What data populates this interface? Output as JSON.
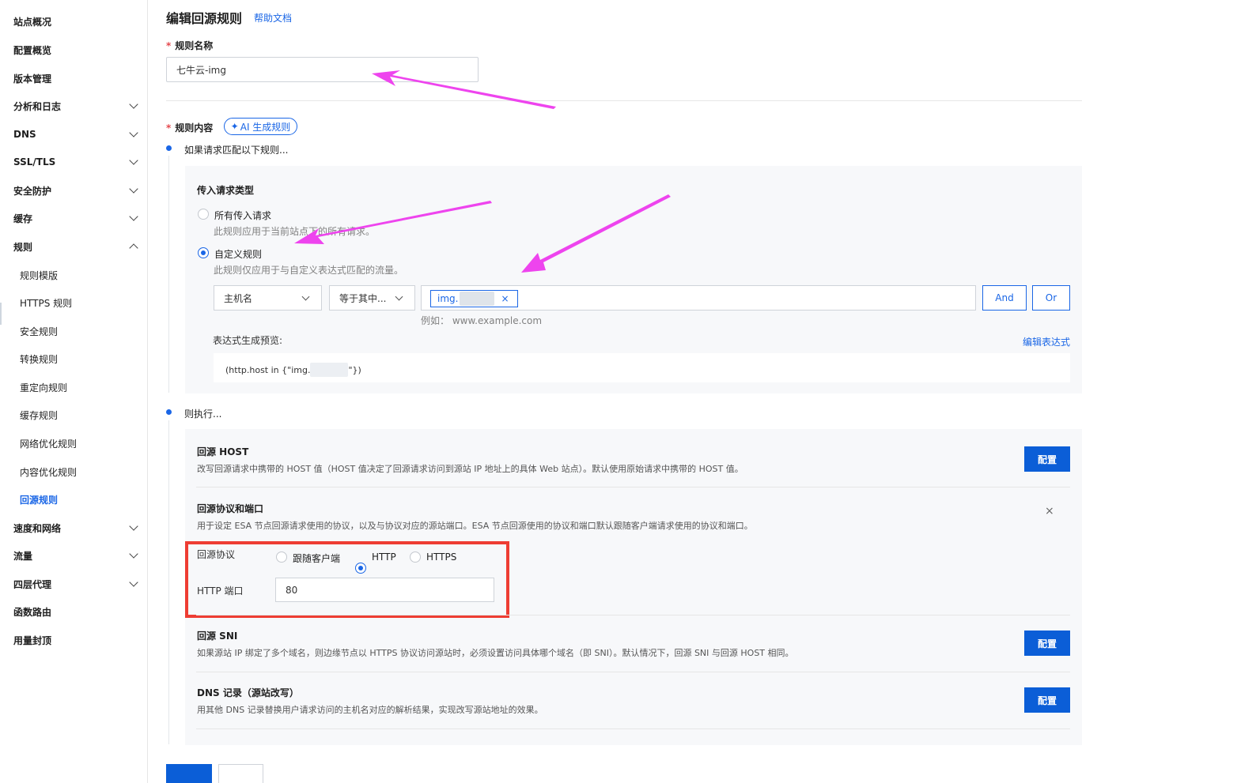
{
  "sidebar": {
    "items": [
      {
        "label": "站点概况",
        "chevron": ""
      },
      {
        "label": "配置概览",
        "chevron": ""
      },
      {
        "label": "版本管理",
        "chevron": ""
      },
      {
        "label": "分析和日志",
        "chevron": "down"
      },
      {
        "label": "DNS",
        "chevron": "down"
      },
      {
        "label": "SSL/TLS",
        "chevron": "down"
      },
      {
        "label": "安全防护",
        "chevron": "down"
      },
      {
        "label": "缓存",
        "chevron": "down"
      },
      {
        "label": "规则",
        "chevron": "up"
      },
      {
        "label": "规则模版",
        "sub": true
      },
      {
        "label": "HTTPS 规则",
        "sub": true
      },
      {
        "label": "安全规则",
        "sub": true
      },
      {
        "label": "转换规则",
        "sub": true
      },
      {
        "label": "重定向规则",
        "sub": true
      },
      {
        "label": "缓存规则",
        "sub": true
      },
      {
        "label": "网络优化规则",
        "sub": true
      },
      {
        "label": "内容优化规则",
        "sub": true
      },
      {
        "label": "回源规则",
        "sub": true,
        "active": true
      },
      {
        "label": "速度和网络",
        "chevron": "down"
      },
      {
        "label": "流量",
        "chevron": "down"
      },
      {
        "label": "四层代理",
        "chevron": "down"
      },
      {
        "label": "函数路由",
        "chevron": ""
      },
      {
        "label": "用量封顶",
        "chevron": ""
      }
    ]
  },
  "header": {
    "title": "编辑回源规则",
    "help": "帮助文档"
  },
  "rule_name": {
    "label": "规则名称",
    "value": "七牛云-img"
  },
  "rule_content": {
    "label": "规则内容",
    "ai_button": "AI 生成规则",
    "ai_icon": "sparkle-icon"
  },
  "match": {
    "heading": "如果请求匹配以下规则...",
    "type_label": "传入请求类型",
    "option_all": "所有传入请求",
    "option_all_desc": "此规则应用于当前站点下的所有请求。",
    "option_custom": "自定义规则",
    "option_custom_desc": "此规则仅应用于与自定义表达式匹配的流量。",
    "selected": "custom",
    "field_select": "主机名",
    "operator_select": "等于其中...",
    "tag_value": "img.",
    "example": "例如：  www.example.com",
    "and_button": "And",
    "or_button": "Or",
    "preview_label": "表达式生成预览:",
    "edit_expression": "编辑表达式",
    "preview_prefix": "(http.host in {\"img.",
    "preview_suffix": "\"})"
  },
  "execute": {
    "heading": "则执行...",
    "configure_label": "配置",
    "rows": [
      {
        "title": "回源 HOST",
        "desc": "改写回源请求中携带的 HOST 值（HOST 值决定了回源请求访问到源站 IP 地址上的具体 Web 站点）。默认使用原始请求中携带的 HOST 值。"
      },
      {
        "title": "回源协议和端口",
        "desc": "用于设定 ESA 节点回源请求使用的协议，以及与协议对应的源站端口。ESA 节点回源使用的协议和端口默认跟随客户端请求使用的协议和端口。"
      },
      {
        "title": "回源 SNI",
        "desc": "如果源站 IP 绑定了多个域名，则边缘节点以 HTTPS 协议访问源站时，必须设置访问具体哪个域名（即 SNI）。默认情况下，回源 SNI 与回源 HOST 相同。"
      },
      {
        "title": "DNS 记录（源站改写）",
        "desc": "用其他 DNS 记录替换用户请求访问的主机名对应的解析结果，实现改写源站地址的效果。"
      }
    ],
    "protocol_label": "回源协议",
    "protocol_options": [
      "跟随客户端",
      "HTTP",
      "HTTPS"
    ],
    "protocol_selected": "HTTP",
    "port_label": "HTTP 端口",
    "port_value": "80"
  },
  "colors": {
    "accent": "#1a66e6",
    "annotation_arrow": "#ee44ee",
    "annotation_box": "#ee3d33"
  }
}
